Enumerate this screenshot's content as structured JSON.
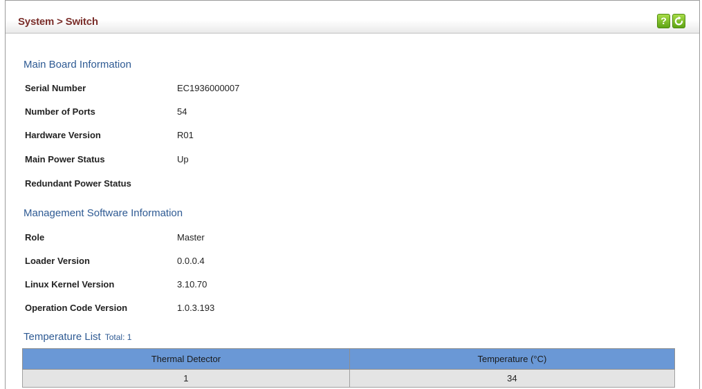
{
  "header": {
    "title": "System > Switch",
    "help_label": "?",
    "help_icon": "help-icon",
    "refresh_icon": "refresh-icon",
    "button_color": "#6db31f"
  },
  "main_board": {
    "title": "Main Board Information",
    "rows": [
      {
        "label": "Serial Number",
        "value": "EC1936000007"
      },
      {
        "label": "Number of Ports",
        "value": "54"
      },
      {
        "label": "Hardware Version",
        "value": "R01"
      },
      {
        "label": "Main Power Status",
        "value": "Up"
      },
      {
        "label": "Redundant Power Status",
        "value": ""
      }
    ]
  },
  "software": {
    "title": "Management Software Information",
    "rows": [
      {
        "label": "Role",
        "value": "Master"
      },
      {
        "label": "Loader Version",
        "value": "0.0.0.4"
      },
      {
        "label": "Linux Kernel Version",
        "value": "3.10.70"
      },
      {
        "label": "Operation Code Version",
        "value": "1.0.3.193"
      }
    ]
  },
  "temperature": {
    "title": "Temperature List",
    "total": "Total: 1",
    "columns": [
      "Thermal Detector",
      "Temperature (°C)"
    ],
    "rows": [
      {
        "detector": "1",
        "temperature": "34"
      }
    ]
  },
  "colors": {
    "title_color": "#7a2e2a",
    "section_color": "#2e5a93",
    "table_header": "#6a98d6",
    "table_row": "#e4e4e4"
  }
}
